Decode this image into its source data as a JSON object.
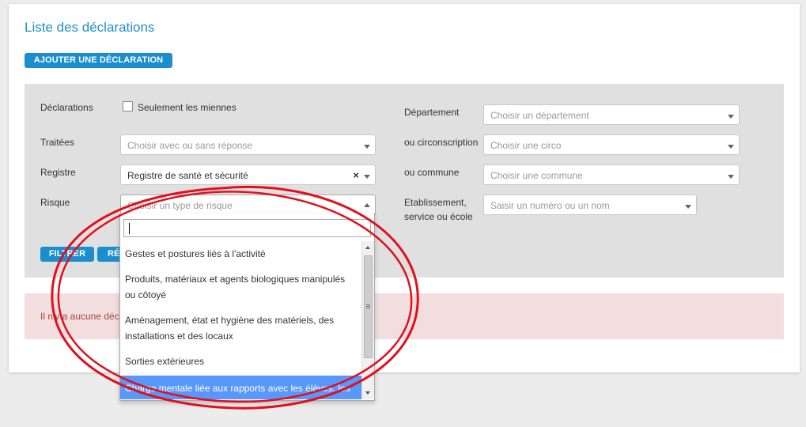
{
  "page": {
    "title": "Liste des déclarations"
  },
  "toolbar": {
    "add_label": "AJOUTER UNE DÉCLARATION"
  },
  "filters": {
    "declarations": {
      "label": "Déclarations",
      "checkbox_label": "Seulement les miennes",
      "checked": false
    },
    "traitees": {
      "label": "Traitées",
      "placeholder": "Choisir avec ou sans réponse"
    },
    "registre": {
      "label": "Registre",
      "value": "Registre de santé et sécurité",
      "clear": "×"
    },
    "risque": {
      "label": "Risque",
      "placeholder": "Choisir un type de risque"
    },
    "departement": {
      "label": "Département",
      "placeholder": "Choisir un département"
    },
    "circonscription": {
      "label": "ou circonscription",
      "placeholder": "Choisir une circo"
    },
    "commune": {
      "label": "ou commune",
      "placeholder": "Choisir une commune"
    },
    "etablissement": {
      "label_line1": "Etablissement,",
      "label_line2": "service ou école",
      "placeholder": "Saisir un numéro ou un nom"
    },
    "filter_label": "FILTRER",
    "reset_label": "RÉ"
  },
  "alert": {
    "text": "Il n'y a aucune déc"
  },
  "risk_dropdown": {
    "search_value": "",
    "options": [
      {
        "lines": [
          "Gestes et postures liés à l'activité"
        ],
        "highlighted": false
      },
      {
        "lines": [
          "Produits, matériaux et agents biologiques manipulés",
          "ou côtoyé"
        ],
        "highlighted": false
      },
      {
        "lines": [
          "Aménagement, état et hygiène des matériels, des",
          "installations et des locaux"
        ],
        "highlighted": false
      },
      {
        "lines": [
          "Sorties extérieures"
        ],
        "highlighted": false
      },
      {
        "lines": [
          "Charge mentale liée aux rapports avec les élèves, les"
        ],
        "highlighted": true
      }
    ]
  },
  "colors": {
    "accent": "#1b8fce",
    "title": "#1e90c8",
    "highlight": "#5897fb",
    "annotation": "#e0101e",
    "alert_bg": "#f2dede"
  }
}
